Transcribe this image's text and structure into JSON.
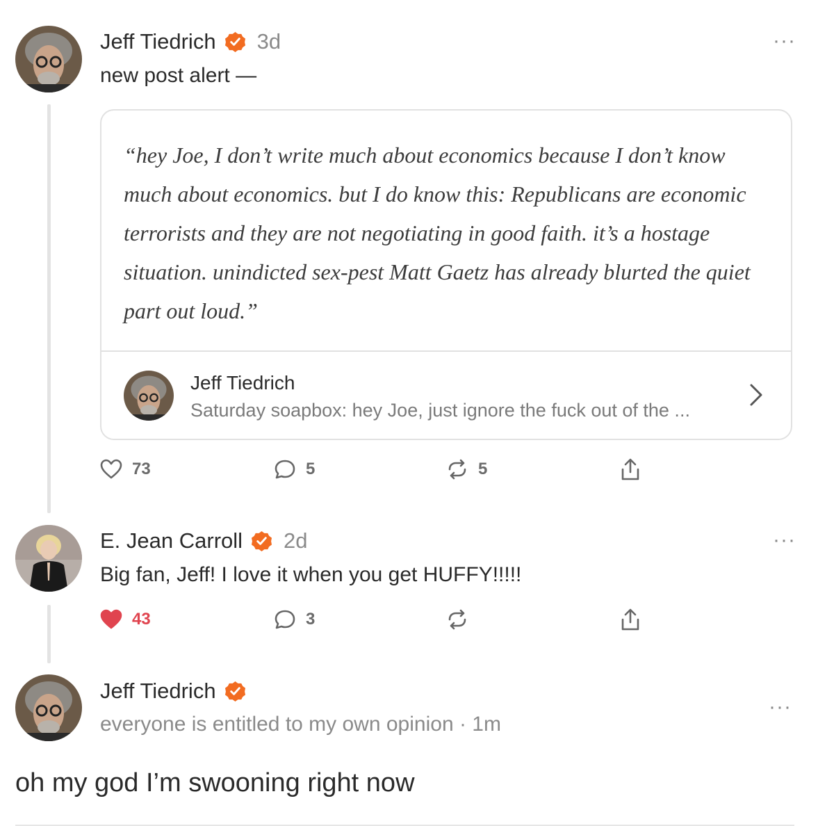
{
  "post": {
    "author": "Jeff Tiedrich",
    "time": "3d",
    "text": "new post alert —",
    "more": "···",
    "quote": {
      "text": "“hey Joe, I don’t write much about economics because I don’t know much about economics. but I do know this: Republicans are economic terrorists and they are not negotiating in good faith. it’s a hostage situation. unindicted sex-pest Matt Gaetz has already blurted the quiet part out loud.”",
      "source_author": "Jeff Tiedrich",
      "source_title": "Saturday soapbox: hey Joe, just ignore the fuck out of the ..."
    },
    "actions": {
      "likes": "73",
      "comments": "5",
      "restacks": "5"
    }
  },
  "reply": {
    "author": "E. Jean Carroll",
    "time": "2d",
    "text": "Big fan, Jeff!  I love it when you get HUFFY!!!!!",
    "more": "···",
    "actions": {
      "likes": "43",
      "comments": "3",
      "restacks": ""
    }
  },
  "compose": {
    "author": "Jeff Tiedrich",
    "handle": "everyone is entitled to my own opinion",
    "time": "1m",
    "more": "···",
    "text": "oh my god I’m swooning right now"
  },
  "colors": {
    "verified": "#f26c21",
    "like_active": "#e0444f",
    "thread_line": "#e3e3e3"
  }
}
